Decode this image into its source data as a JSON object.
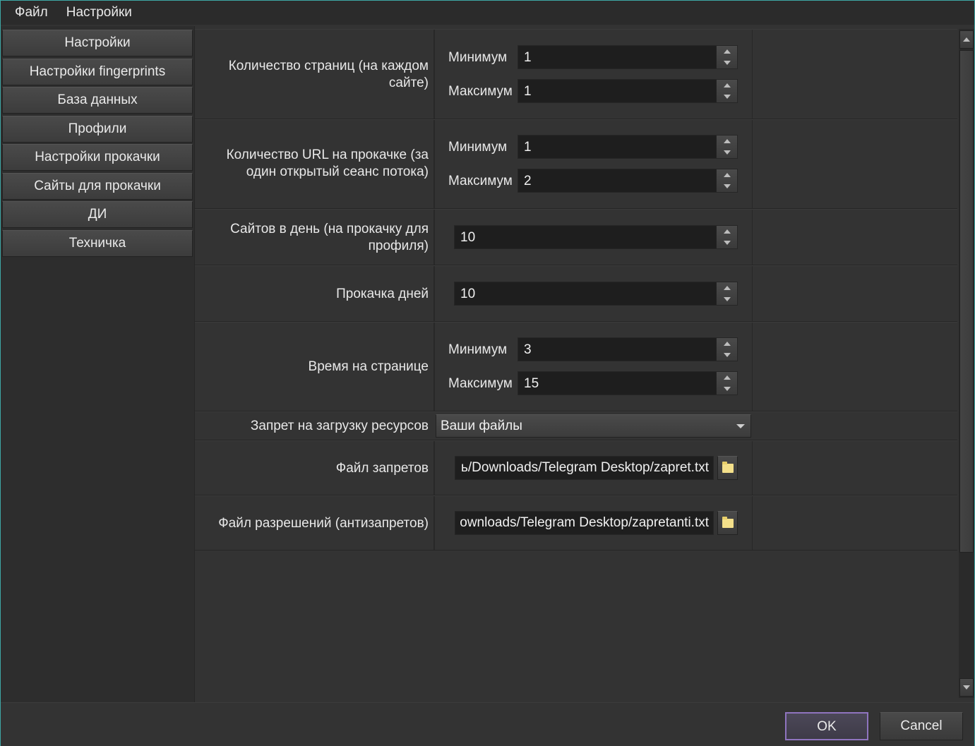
{
  "menu": [
    "Файл",
    "Настройки"
  ],
  "sidebar": {
    "items": [
      {
        "label": "Настройки"
      },
      {
        "label": "Настройки fingerprints"
      },
      {
        "label": "База данных"
      },
      {
        "label": "Профили"
      },
      {
        "label": "Настройки прокачки"
      },
      {
        "label": "Сайты для прокачки"
      },
      {
        "label": "ДИ"
      },
      {
        "label": "Техничка"
      }
    ]
  },
  "common": {
    "min_label": "Минимум",
    "max_label": "Максимум"
  },
  "rows": {
    "pages_per_site": {
      "label": "Количество страниц (на каждом сайте)",
      "min": "1",
      "max": "1"
    },
    "urls_per_session": {
      "label": "Количество URL на прокачке (за один открытый сеанс потока)",
      "min": "1",
      "max": "2"
    },
    "sites_per_day": {
      "label": "Сайтов в день (на прокачку для профиля)",
      "value": "10"
    },
    "boost_days": {
      "label": "Прокачка дней",
      "value": "10"
    },
    "time_on_page": {
      "label": "Время на странице",
      "min": "3",
      "max": "15"
    },
    "resource_block": {
      "label": "Запрет на загрузку ресурсов",
      "selected": "Ваши файлы"
    },
    "ban_file": {
      "label": "Файл запретов",
      "path": "ь/Downloads/Telegram Desktop/zapret.txt"
    },
    "allow_file": {
      "label": "Файл разрешений (антизапретов)",
      "path": "ownloads/Telegram Desktop/zapretanti.txt"
    }
  },
  "buttons": {
    "ok": "OK",
    "cancel": "Cancel"
  },
  "colors": {
    "accent_border": "#3ea7a5",
    "ok_border": "#8f74bf",
    "field_bg": "#1e1e1e",
    "panel_bg": "#333333"
  }
}
